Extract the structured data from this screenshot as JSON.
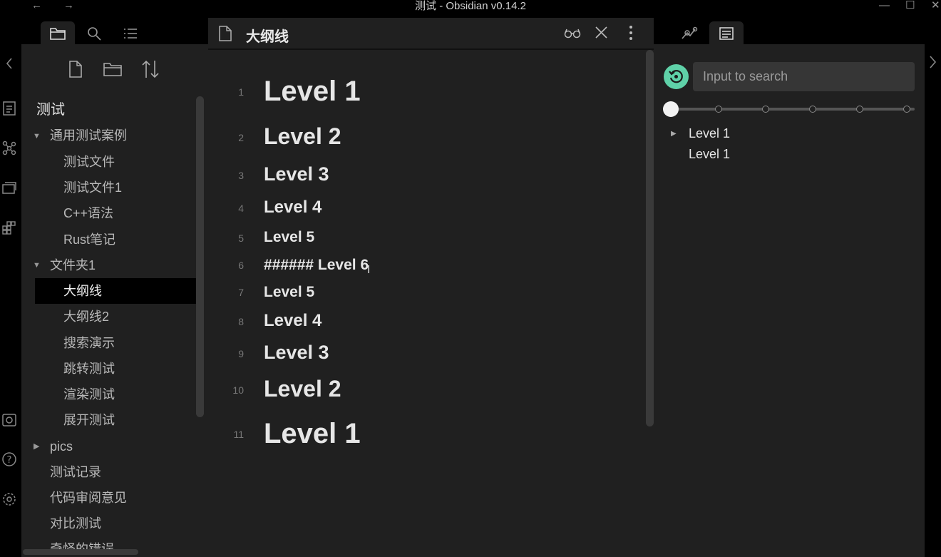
{
  "window": {
    "title": "测试 - Obsidian v0.14.2"
  },
  "file_tree": {
    "vault_name": "测试",
    "items": [
      {
        "label": "通用测试案例",
        "type": "folder",
        "expanded": true
      },
      {
        "label": "测试文件",
        "type": "file"
      },
      {
        "label": "测试文件1",
        "type": "file"
      },
      {
        "label": "C++语法",
        "type": "file"
      },
      {
        "label": "Rust笔记",
        "type": "file"
      },
      {
        "label": "文件夹1",
        "type": "folder",
        "expanded": true
      },
      {
        "label": "大纲线",
        "type": "file",
        "active": true
      },
      {
        "label": "大纲线2",
        "type": "file"
      },
      {
        "label": "搜索演示",
        "type": "file"
      },
      {
        "label": "跳转测试",
        "type": "file"
      },
      {
        "label": "渲染测试",
        "type": "file"
      },
      {
        "label": "展开测试",
        "type": "file"
      },
      {
        "label": "pics",
        "type": "folder",
        "expanded": false
      },
      {
        "label": "测试记录",
        "type": "file"
      },
      {
        "label": "代码审阅意见",
        "type": "file"
      },
      {
        "label": "对比测试",
        "type": "file"
      },
      {
        "label": "奇怪的错误",
        "type": "file"
      }
    ]
  },
  "editor": {
    "filename": "大纲线",
    "lines": [
      {
        "num": "1",
        "text": "Level 1",
        "level": 1
      },
      {
        "num": "2",
        "text": "Level 2",
        "level": 2
      },
      {
        "num": "3",
        "text": "Level 3",
        "level": 3
      },
      {
        "num": "4",
        "text": "Level 4",
        "level": 4
      },
      {
        "num": "5",
        "text": "Level 5",
        "level": 5
      },
      {
        "num": "6",
        "text": "###### Level 6",
        "level": 6
      },
      {
        "num": "7",
        "text": "Level 5",
        "level": 5
      },
      {
        "num": "8",
        "text": "Level 4",
        "level": 4
      },
      {
        "num": "9",
        "text": "Level 3",
        "level": 3
      },
      {
        "num": "10",
        "text": "Level 2",
        "level": 2
      },
      {
        "num": "11",
        "text": "Level 1",
        "level": 1
      }
    ]
  },
  "outline": {
    "search_placeholder": "Input to search",
    "slider_level": 0,
    "items": [
      {
        "label": "Level 1",
        "collapsed": true
      },
      {
        "label": "Level 1",
        "collapsed": false
      }
    ]
  },
  "colors": {
    "accent": "#5fd1a8",
    "panel_bg": "#202020",
    "active_file_bg": "#000000"
  }
}
